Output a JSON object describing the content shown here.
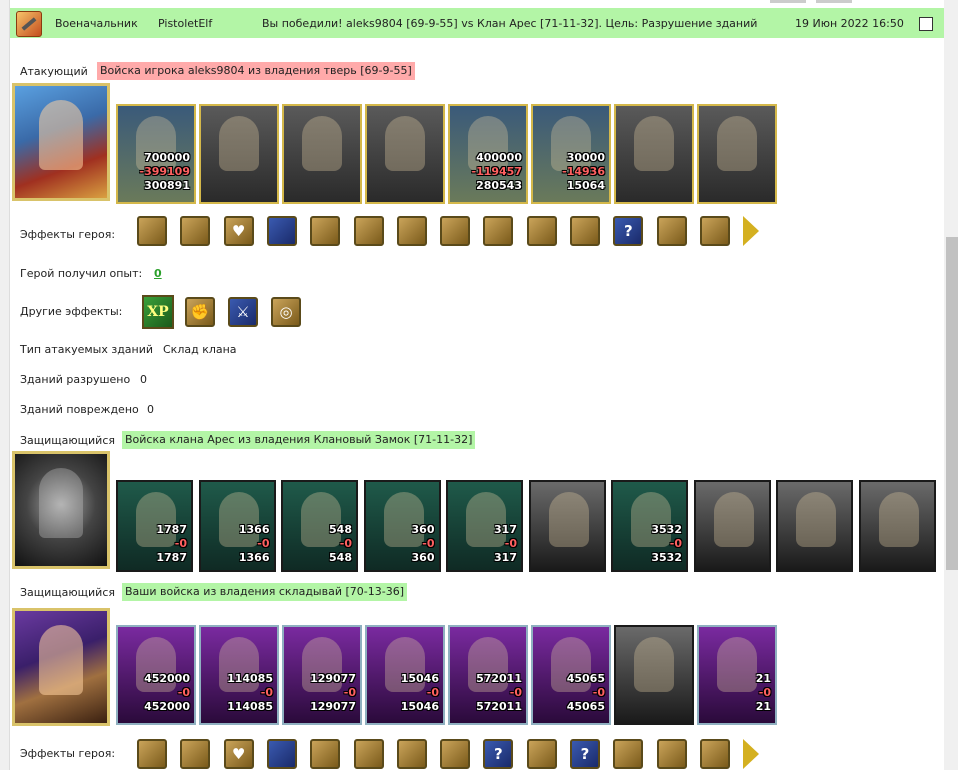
{
  "header": {
    "role_label": "Военачальник",
    "player": "PistoletElf",
    "result_text": "Вы победили! aleks9804 [69-9-55] vs Клан Арес [71-11-32]. Цель: Разрушение зданий",
    "datetime": "19 Июн 2022 16:50"
  },
  "attacker": {
    "label": "Атакующий",
    "title": "Войска игрока aleks9804 из владения тверь [69-9-55]",
    "stacks": [
      {
        "a": "700000",
        "b": "-399109",
        "c": "300891"
      },
      {
        "a": "",
        "b": "",
        "c": ""
      },
      {
        "a": "",
        "b": "",
        "c": ""
      },
      {
        "a": "",
        "b": "",
        "c": ""
      },
      {
        "a": "400000",
        "b": "-119457",
        "c": "280543"
      },
      {
        "a": "30000",
        "b": "-14936",
        "c": "15064"
      },
      {
        "a": "",
        "b": "",
        "c": ""
      },
      {
        "a": "",
        "b": "",
        "c": ""
      }
    ],
    "effects_label": "Эффекты героя:",
    "exp_label": "Герой получил опыт:",
    "exp_value": "0",
    "other_effects_label": "Другие эффекты:",
    "xp_badge": "XP"
  },
  "info": {
    "building_type_label": "Тип атакуемых зданий",
    "building_type_value": "Склад клана",
    "destroyed_label": "Зданий разрушено",
    "destroyed_value": "0",
    "damaged_label": "Зданий повреждено",
    "damaged_value": "0"
  },
  "defender1": {
    "label": "Защищающийся",
    "title": "Войска клана Арес из владения Клановый Замок [71-11-32]",
    "stacks": [
      {
        "a": "1787",
        "b": "-0",
        "c": "1787"
      },
      {
        "a": "1366",
        "b": "-0",
        "c": "1366"
      },
      {
        "a": "548",
        "b": "-0",
        "c": "548"
      },
      {
        "a": "360",
        "b": "-0",
        "c": "360"
      },
      {
        "a": "317",
        "b": "-0",
        "c": "317"
      },
      {
        "a": "",
        "b": "",
        "c": ""
      },
      {
        "a": "3532",
        "b": "-0",
        "c": "3532"
      },
      {
        "a": "",
        "b": "",
        "c": ""
      },
      {
        "a": "",
        "b": "",
        "c": ""
      },
      {
        "a": "",
        "b": "",
        "c": ""
      }
    ]
  },
  "defender2": {
    "label": "Защищающийся",
    "title": "Ваши войска из владения складывай [70-13-36]",
    "stacks": [
      {
        "a": "452000",
        "b": "-0",
        "c": "452000"
      },
      {
        "a": "114085",
        "b": "-0",
        "c": "114085"
      },
      {
        "a": "129077",
        "b": "-0",
        "c": "129077"
      },
      {
        "a": "15046",
        "b": "-0",
        "c": "15046"
      },
      {
        "a": "572011",
        "b": "-0",
        "c": "572011"
      },
      {
        "a": "45065",
        "b": "-0",
        "c": "45065"
      },
      {
        "a": "",
        "b": "",
        "c": ""
      },
      {
        "a": "21",
        "b": "-0",
        "c": "21"
      }
    ],
    "effects_label": "Эффекты героя:"
  },
  "icons": {
    "hero1_effects": [
      "book-icon",
      "castle-icon",
      "heart-icon",
      "shield-icon",
      "gold-helmet-icon",
      "armor-icon",
      "potion-icon",
      "knight-helmet-icon",
      "sword-icon",
      "spikes-icon",
      "ring-icon",
      "help-icon",
      "crossed-swords-icon",
      "torch-icon"
    ],
    "other_effects": [
      "xp-icon",
      "fist-icon",
      "sword-icon",
      "coins-icon"
    ],
    "hero3_effects": [
      "armor-icon",
      "book-icon",
      "heart-icon",
      "shield-icon",
      "wings-icon",
      "amulet-icon",
      "armor-purple-icon",
      "fist-icon",
      "help-icon",
      "gem-icon",
      "help-icon",
      "scythe-icon",
      "medal-icon",
      "scroll-icon"
    ]
  }
}
